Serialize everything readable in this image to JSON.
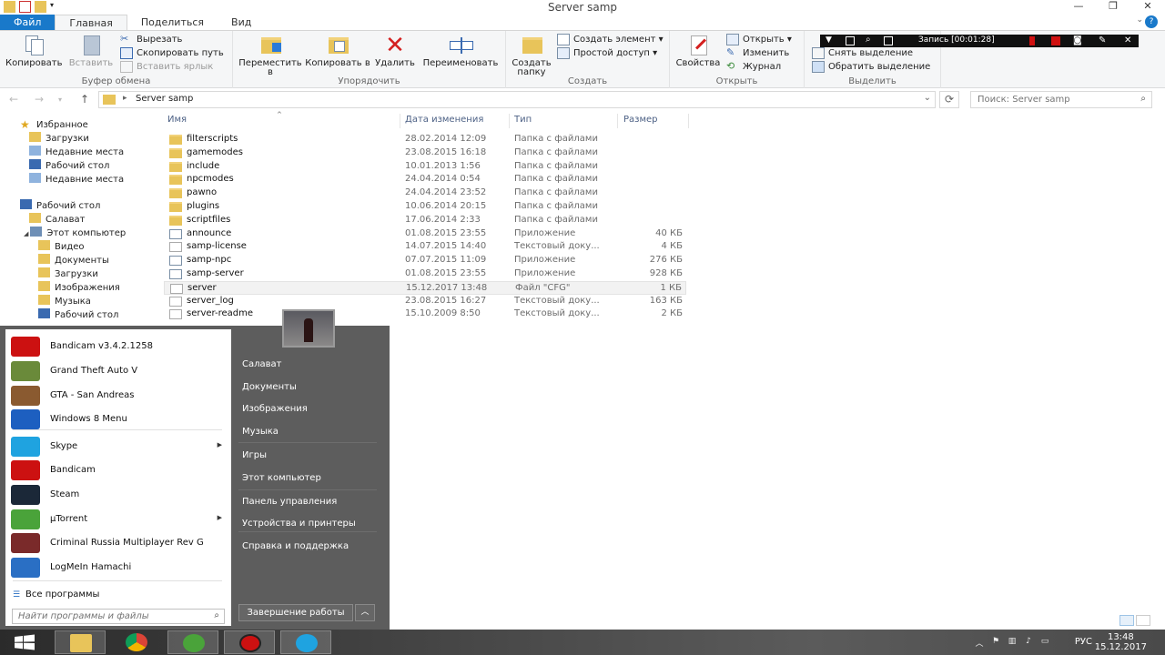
{
  "window": {
    "title": "Server samp"
  },
  "ribbon_tabs": [
    "Файл",
    "Главная",
    "Поделиться",
    "Вид"
  ],
  "ribbon": {
    "clipboard": {
      "copy": "Копировать",
      "paste": "Вставить",
      "cut": "Вырезать",
      "copy_path": "Скопировать путь",
      "paste_shortcut": "Вставить ярлык",
      "label": "Буфер обмена"
    },
    "organize": {
      "move_to": "Переместить в",
      "copy_to": "Копировать в",
      "delete": "Удалить",
      "rename": "Переименовать",
      "label": "Упорядочить"
    },
    "create": {
      "new_folder": "Создать папку",
      "new_item": "Создать элемент",
      "easy_access": "Простой доступ",
      "label": "Создать"
    },
    "open": {
      "properties": "Свойства",
      "open": "Открыть",
      "edit": "Изменить",
      "history": "Журнал",
      "label": "Открыть"
    },
    "select": {
      "select_none": "Снять выделение",
      "invert": "Обратить выделение",
      "label": "Выделить"
    }
  },
  "recording": {
    "text": "Запись [00:01:28]"
  },
  "address": {
    "crumb": "Server samp",
    "search_placeholder": "Поиск: Server samp"
  },
  "nav": {
    "favorites": "Избранное",
    "favorites_items": [
      "Загрузки",
      "Недавние места",
      "Рабочий стол",
      "Недавние места"
    ],
    "desktop": "Рабочий стол",
    "desktop_items": [
      "Салават",
      "Этот компьютер"
    ],
    "computer_items": [
      "Видео",
      "Документы",
      "Загрузки",
      "Изображения",
      "Музыка",
      "Рабочий стол"
    ]
  },
  "columns": {
    "name": "Имя",
    "date": "Дата изменения",
    "type": "Тип",
    "size": "Размер"
  },
  "files": [
    {
      "name": "filterscripts",
      "date": "28.02.2014 12:09",
      "type": "Папка с файлами",
      "size": "",
      "kind": "folder"
    },
    {
      "name": "gamemodes",
      "date": "23.08.2015 16:18",
      "type": "Папка с файлами",
      "size": "",
      "kind": "folder"
    },
    {
      "name": "include",
      "date": "10.01.2013 1:56",
      "type": "Папка с файлами",
      "size": "",
      "kind": "folder"
    },
    {
      "name": "npcmodes",
      "date": "24.04.2014 0:54",
      "type": "Папка с файлами",
      "size": "",
      "kind": "folder"
    },
    {
      "name": "pawno",
      "date": "24.04.2014 23:52",
      "type": "Папка с файлами",
      "size": "",
      "kind": "folder"
    },
    {
      "name": "plugins",
      "date": "10.06.2014 20:15",
      "type": "Папка с файлами",
      "size": "",
      "kind": "folder"
    },
    {
      "name": "scriptfiles",
      "date": "17.06.2014 2:33",
      "type": "Папка с файлами",
      "size": "",
      "kind": "folder"
    },
    {
      "name": "announce",
      "date": "01.08.2015 23:55",
      "type": "Приложение",
      "size": "40 КБ",
      "kind": "app"
    },
    {
      "name": "samp-license",
      "date": "14.07.2015 14:40",
      "type": "Текстовый доку...",
      "size": "4 КБ",
      "kind": "txt"
    },
    {
      "name": "samp-npc",
      "date": "07.07.2015 11:09",
      "type": "Приложение",
      "size": "276 КБ",
      "kind": "app"
    },
    {
      "name": "samp-server",
      "date": "01.08.2015 23:55",
      "type": "Приложение",
      "size": "928 КБ",
      "kind": "app"
    },
    {
      "name": "server",
      "date": "15.12.2017 13:48",
      "type": "Файл \"CFG\"",
      "size": "1 КБ",
      "kind": "txt"
    },
    {
      "name": "server_log",
      "date": "23.08.2015 16:27",
      "type": "Текстовый доку...",
      "size": "163 КБ",
      "kind": "txt"
    },
    {
      "name": "server-readme",
      "date": "15.10.2009 8:50",
      "type": "Текстовый доку...",
      "size": "2 КБ",
      "kind": "txt"
    }
  ],
  "startmenu": {
    "programs": [
      {
        "label": "Bandicam v3.4.2.1258",
        "color": "#cc1111",
        "submenu": false
      },
      {
        "label": "Grand Theft Auto V",
        "color": "#6a8a3a",
        "submenu": false
      },
      {
        "label": "GTA - San Andreas",
        "color": "#8a5a30",
        "submenu": false
      },
      {
        "label": "Windows 8 Menu",
        "color": "#1d5fc0",
        "submenu": false
      },
      {
        "label": "Skype",
        "color": "#1fa3e0",
        "submenu": true
      },
      {
        "label": "Bandicam",
        "color": "#cc1111",
        "submenu": false
      },
      {
        "label": "Steam",
        "color": "#1b2838",
        "submenu": false
      },
      {
        "label": "µTorrent",
        "color": "#4aa33a",
        "submenu": true
      },
      {
        "label": "Criminal Russia Multiplayer Rev G",
        "color": "#7a2a2a",
        "submenu": false
      },
      {
        "label": "LogMeIn Hamachi",
        "color": "#2a6fc4",
        "submenu": false
      }
    ],
    "all_programs": "Все программы",
    "search_placeholder": "Найти программы и файлы",
    "right_links": [
      "Салават",
      "Документы",
      "Изображения",
      "Музыка",
      "Игры",
      "Этот компьютер",
      "Панель управления",
      "Устройства и принтеры",
      "Справка и поддержка"
    ],
    "shutdown": "Завершение работы"
  },
  "taskbar": {
    "lang": "РУС",
    "time": "13:48",
    "date": "15.12.2017"
  }
}
